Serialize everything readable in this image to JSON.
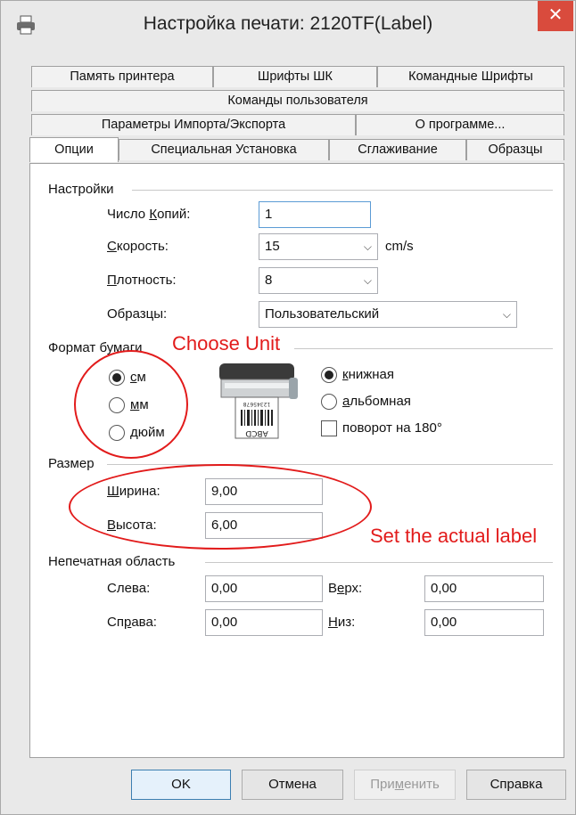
{
  "window": {
    "title": "Настройка печати: 2120TF(Label)",
    "close_glyph": "✕",
    "app_icon": "printer-icon"
  },
  "tabs": {
    "row1": [
      "Память принтера",
      "Шрифты ШК",
      "Командные Шрифты"
    ],
    "row2": [
      "Команды пользователя"
    ],
    "row3": [
      "Параметры Импорта/Экспорта",
      "О программе..."
    ],
    "row4": [
      "Опции",
      "Специальная Установка",
      "Сглаживание",
      "Образцы"
    ],
    "active": "Опции"
  },
  "settings": {
    "group_title": "Настройки",
    "copies_label_pre": "Число ",
    "copies_label_u": "К",
    "copies_label_post": "опий:",
    "copies_value": "1",
    "speed_label_u": "С",
    "speed_label_post": "корость:",
    "speed_value": "15",
    "speed_unit": "cm/s",
    "density_label_u": "П",
    "density_label_post": "лотность:",
    "density_value": "8",
    "samples_label": "Образцы:",
    "samples_value": "Пользовательский"
  },
  "paper": {
    "group_title": "Формат бумаги",
    "units": [
      {
        "label_u": "с",
        "label_post": "м",
        "selected": true
      },
      {
        "label_u": "м",
        "label_post": "м",
        "selected": false
      },
      {
        "label_u": "д",
        "label_post": "юйм",
        "selected": false
      }
    ],
    "portrait_label_u": "к",
    "portrait_label_post": "нижная",
    "landscape_label_u": "а",
    "landscape_label_post": "льбомная",
    "rotate_label": "поворот на 180°",
    "portrait_selected": true,
    "landscape_selected": false,
    "rotate_checked": false,
    "label_preview_text": "ABCD",
    "label_preview_digits": "12345678"
  },
  "size": {
    "group_title": "Размер",
    "width_label_u": "Ш",
    "width_label_post": "ирина:",
    "width_value": "9,00",
    "height_label_u": "В",
    "height_label_post": "ысота:",
    "height_value": "6,00"
  },
  "unprintable": {
    "group_title": "Непечатная область",
    "left_label": "Слева:",
    "left_value": "0,00",
    "right_label_pre": "Сп",
    "right_label_u": "р",
    "right_label_post": "ава:",
    "right_value": "0,00",
    "top_label_pre": "В",
    "top_label_u": "е",
    "top_label_post": "рх:",
    "top_value": "0,00",
    "bottom_label_u": "Н",
    "bottom_label_post": "из:",
    "bottom_value": "0,00"
  },
  "buttons": {
    "ok": "OK",
    "cancel": "Отмена",
    "apply_pre": "При",
    "apply_u": "м",
    "apply_post": "енить",
    "help": "Справка"
  },
  "annotations": {
    "choose_unit": "Choose Unit",
    "set_label": "Set the actual label",
    "color": "#e21b1b"
  }
}
